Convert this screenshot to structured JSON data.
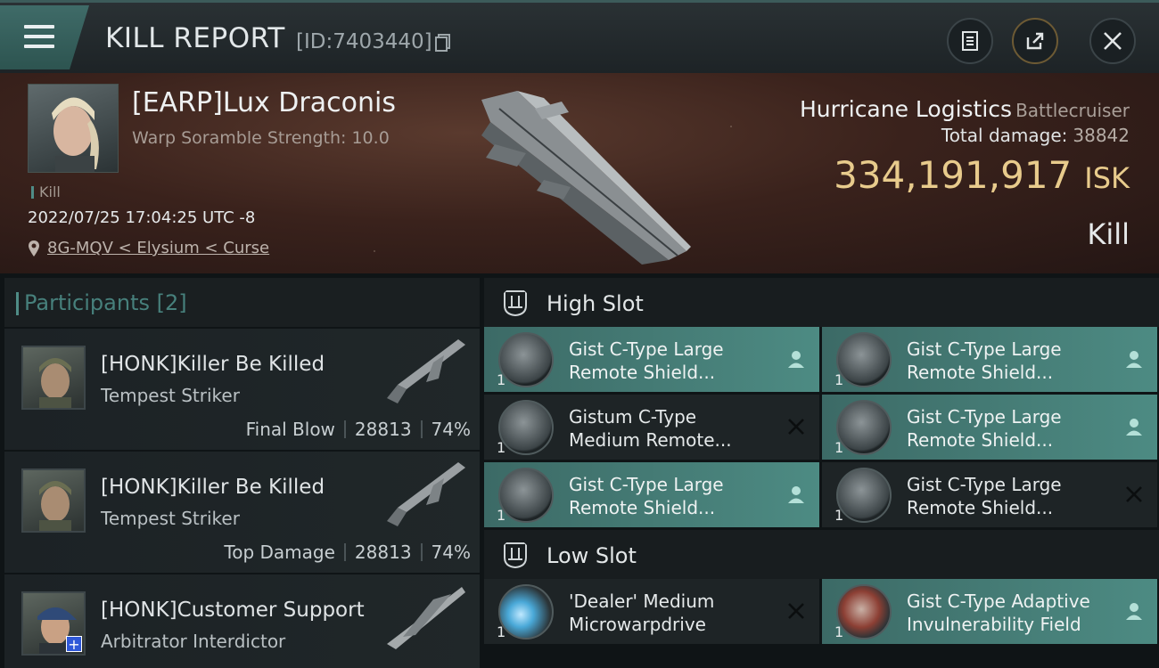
{
  "titlebar": {
    "title": "KILL REPORT",
    "report_id": "[ID:7403440]"
  },
  "victim": {
    "name": "[EARP]Lux Draconis",
    "subtitle": "Warp Soramble Strength: 10.0",
    "type_tag": "Kill",
    "time": "2022/07/25 17:04:25 UTC -8",
    "location": "8G-MQV < Elysium < Curse"
  },
  "ship": {
    "name": "Hurricane Logistics",
    "class": "Battlecruiser",
    "total_damage_label": "Total damage:",
    "total_damage": "38842",
    "value": "334,191,917",
    "value_unit": "ISK",
    "result": "Kill"
  },
  "participants": {
    "header": "Participants [2]",
    "rows": [
      {
        "name": "[HONK]Killer Be Killed",
        "ship": "Tempest Striker",
        "role": "Final Blow",
        "damage": "28813",
        "percent": "74%"
      },
      {
        "name": "[HONK]Killer Be Killed",
        "ship": "Tempest Striker",
        "role": "Top Damage",
        "damage": "28813",
        "percent": "74%"
      },
      {
        "name": "[HONK]Customer Support",
        "ship": "Arbitrator Interdictor"
      }
    ]
  },
  "high_slot": {
    "label": "High Slot",
    "modules": [
      {
        "l1": "Gist C-Type Large",
        "l2": "Remote Shield...",
        "qty": "1",
        "status": "fitted"
      },
      {
        "l1": "Gist C-Type Large",
        "l2": "Remote Shield...",
        "qty": "1",
        "status": "fitted"
      },
      {
        "l1": "Gistum C-Type",
        "l2": "Medium Remote...",
        "qty": "1",
        "status": "destroyed"
      },
      {
        "l1": "Gist C-Type Large",
        "l2": "Remote Shield...",
        "qty": "1",
        "status": "fitted"
      },
      {
        "l1": "Gist C-Type Large",
        "l2": "Remote Shield...",
        "qty": "1",
        "status": "fitted"
      },
      {
        "l1": "Gist C-Type Large",
        "l2": "Remote Shield...",
        "qty": "1",
        "status": "destroyed"
      }
    ]
  },
  "low_slot": {
    "label": "Low Slot",
    "modules": [
      {
        "l1": "'Dealer' Medium",
        "l2": "Microwarpdrive",
        "qty": "1",
        "status": "destroyed"
      },
      {
        "l1": "Gist C-Type Adaptive",
        "l2": "Invulnerability Field",
        "qty": "1",
        "status": "fitted"
      }
    ]
  },
  "colors": {
    "accent": "#4d8b83",
    "isk": "#e8cb8c",
    "hero_bg": "#3a221c"
  },
  "icons": [
    "menu-icon",
    "copy-icon",
    "clipboard-icon",
    "share-icon",
    "close-icon",
    "location-pin-icon",
    "slot-icon",
    "person-icon",
    "x-icon"
  ]
}
